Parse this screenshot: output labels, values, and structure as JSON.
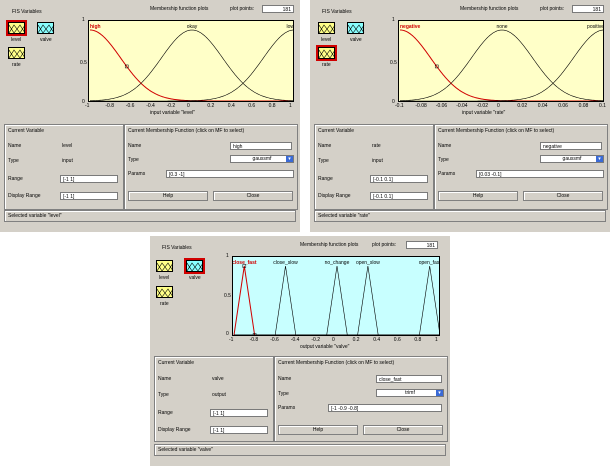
{
  "common": {
    "fis_variables": "FIS Variables",
    "mf_plots": "Membership function plots",
    "plot_points_label": "plot points:",
    "current_variable": "Current Variable",
    "name_label": "Name",
    "type_label": "Type",
    "range_label": "Range",
    "display_range_label": "Display Range",
    "cmf_title": "Current Membership Function (click on MF to select)",
    "params_label": "Params",
    "help": "Help",
    "close": "Close"
  },
  "var_icons": {
    "level": "level",
    "valve": "valve",
    "rate": "rate"
  },
  "panels": [
    {
      "plot_points": "181",
      "mf_labels": [
        "high",
        "okay",
        "low"
      ],
      "xticks": [
        "-1",
        "-0.8",
        "-0.6",
        "-0.4",
        "-0.2",
        "0",
        "0.2",
        "0.4",
        "0.6",
        "0.8",
        "1"
      ],
      "yticks": [
        "1",
        "0.5",
        "0"
      ],
      "xlabel": "input variable \"level\"",
      "cv_name": "level",
      "cv_type": "input",
      "cv_range": "[-1 1]",
      "cv_display_range": "[-1 1]",
      "mf_name": "high",
      "mf_type": "gaussmf",
      "mf_params": "[0.3 -1]",
      "status": "Selected variable \"level\""
    },
    {
      "plot_points": "181",
      "mf_labels": [
        "negative",
        "none",
        "positive"
      ],
      "xticks": [
        "-0.1",
        "-0.08",
        "-0.06",
        "-0.04",
        "-0.02",
        "0",
        "0.02",
        "0.04",
        "0.06",
        "0.08",
        "0.1"
      ],
      "yticks": [
        "1",
        "0.5",
        "0"
      ],
      "xlabel": "input variable \"rate\"",
      "cv_name": "rate",
      "cv_type": "input",
      "cv_range": "[-0.1 0.1]",
      "cv_display_range": "[-0.1 0.1]",
      "mf_name": "negative",
      "mf_type": "gaussmf",
      "mf_params": "[0.03 -0.1]",
      "status": "Selected variable \"rate\""
    },
    {
      "plot_points": "181",
      "mf_labels": [
        "close_fast",
        "close_slow",
        "no_change",
        "open_slow",
        "open_fast"
      ],
      "xticks": [
        "-1",
        "-0.8",
        "-0.6",
        "-0.4",
        "-0.2",
        "0",
        "0.2",
        "0.4",
        "0.6",
        "0.8",
        "1"
      ],
      "yticks": [
        "1",
        "0.5",
        "0"
      ],
      "xlabel": "output variable \"valve\"",
      "cv_name": "valve",
      "cv_type": "output",
      "cv_range": "[-1 1]",
      "cv_display_range": "[-1 1]",
      "mf_name": "close_fast",
      "mf_type": "trimf",
      "mf_params": "[-1 -0.9 -0.8]",
      "status": "Selected variable \"valve\""
    }
  ],
  "chart_data": [
    {
      "type": "line",
      "xlim": [
        -1,
        1
      ],
      "ylim": [
        0,
        1
      ],
      "xlabel": "input variable \"level\"",
      "plot_background": "#ffffc8",
      "series": [
        {
          "name": "high",
          "shape": "gaussmf",
          "params": [
            0.3,
            -1
          ],
          "color": "#d00000"
        },
        {
          "name": "okay",
          "shape": "gaussmf",
          "params": [
            0.3,
            0
          ],
          "color": "#000000"
        },
        {
          "name": "low",
          "shape": "gaussmf",
          "params": [
            0.3,
            1
          ],
          "color": "#000000"
        }
      ]
    },
    {
      "type": "line",
      "xlim": [
        -0.1,
        0.1
      ],
      "ylim": [
        0,
        1
      ],
      "xlabel": "input variable \"rate\"",
      "plot_background": "#ffffc8",
      "series": [
        {
          "name": "negative",
          "shape": "gaussmf",
          "params": [
            0.03,
            -0.1
          ],
          "color": "#d00000"
        },
        {
          "name": "none",
          "shape": "gaussmf",
          "params": [
            0.03,
            0
          ],
          "color": "#000000"
        },
        {
          "name": "positive",
          "shape": "gaussmf",
          "params": [
            0.03,
            0.1
          ],
          "color": "#000000"
        }
      ]
    },
    {
      "type": "line",
      "xlim": [
        -1,
        1
      ],
      "ylim": [
        0,
        1
      ],
      "xlabel": "output variable \"valve\"",
      "plot_background": "#c8ffff",
      "series": [
        {
          "name": "close_fast",
          "shape": "trimf",
          "params": [
            -1,
            -0.9,
            -0.8
          ],
          "color": "#d00000"
        },
        {
          "name": "close_slow",
          "shape": "trimf",
          "params": [
            -0.6,
            -0.5,
            -0.4
          ],
          "color": "#000000"
        },
        {
          "name": "no_change",
          "shape": "trimf",
          "params": [
            -0.1,
            0,
            0.1
          ],
          "color": "#000000"
        },
        {
          "name": "open_slow",
          "shape": "trimf",
          "params": [
            0.2,
            0.3,
            0.4
          ],
          "color": "#000000"
        },
        {
          "name": "open_fast",
          "shape": "trimf",
          "params": [
            0.8,
            0.9,
            1
          ],
          "color": "#000000"
        }
      ]
    }
  ]
}
